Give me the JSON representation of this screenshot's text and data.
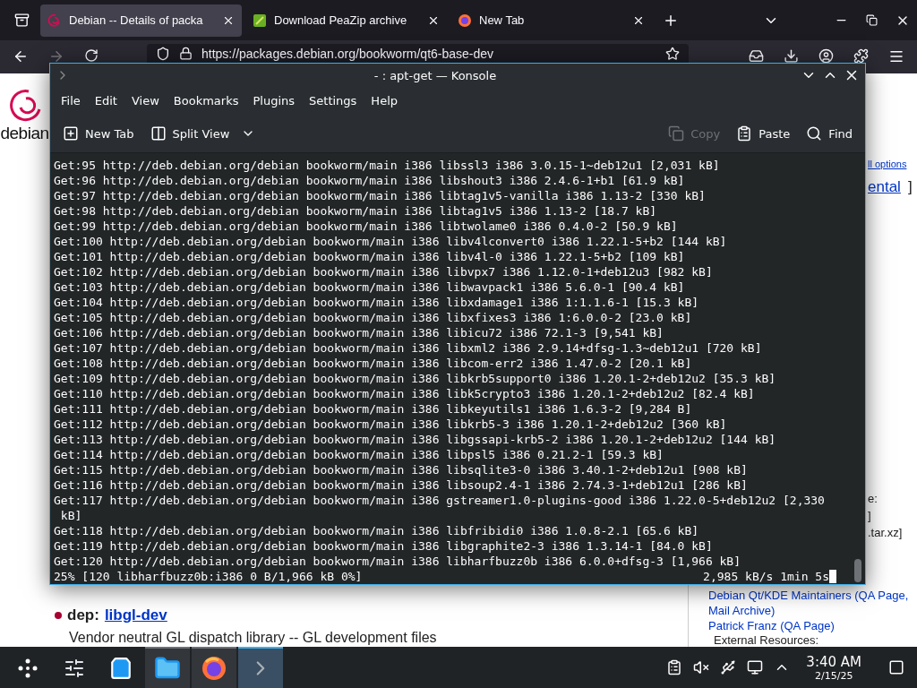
{
  "browser": {
    "tabs": [
      {
        "title": "Debian -- Details of packa",
        "kind": "debian",
        "selected": true
      },
      {
        "title": "Download PeaZip archive",
        "kind": "peazip",
        "selected": false
      },
      {
        "title": "New Tab",
        "kind": "firefox",
        "selected": false
      }
    ],
    "url": "https://packages.debian.org/bookworm/qt6-base-dev"
  },
  "page": {
    "logo_text": "debian",
    "side_top": {
      "options_link": "ll options",
      "suite_link": "ental",
      "suite_bracket": "]"
    },
    "side_files": [
      "e:",
      "]",
      ".tar.xz]"
    ],
    "maintainers": [
      "Debian Qt/KDE Maintainers (QA Page, Mail Archive)",
      "Patrick Franz (QA Page)"
    ],
    "external_heading": "External Resources:",
    "dep": {
      "label": "dep:",
      "link": "libgl-dev",
      "description": "Vendor neutral GL dispatch library -- GL development files"
    }
  },
  "konsole": {
    "title": "- : apt-get — Konsole",
    "menu": [
      "File",
      "Edit",
      "View",
      "Bookmarks",
      "Plugins",
      "Settings",
      "Help"
    ],
    "toolbar": [
      {
        "label": "New Tab",
        "kind": "new-tab",
        "disabled": false
      },
      {
        "label": "Split View",
        "kind": "split-view",
        "disabled": false
      },
      {
        "label": "Copy",
        "kind": "copy",
        "disabled": true
      },
      {
        "label": "Paste",
        "kind": "paste",
        "disabled": false
      },
      {
        "label": "Find",
        "kind": "find",
        "disabled": false
      }
    ],
    "lines": [
      "Get:95 http://deb.debian.org/debian bookworm/main i386 libssl3 i386 3.0.15-1~deb12u1 [2,031 kB]",
      "Get:96 http://deb.debian.org/debian bookworm/main i386 libshout3 i386 2.4.6-1+b1 [61.9 kB]",
      "Get:97 http://deb.debian.org/debian bookworm/main i386 libtag1v5-vanilla i386 1.13-2 [330 kB]",
      "Get:98 http://deb.debian.org/debian bookworm/main i386 libtag1v5 i386 1.13-2 [18.7 kB]",
      "Get:99 http://deb.debian.org/debian bookworm/main i386 libtwolame0 i386 0.4.0-2 [50.9 kB]",
      "Get:100 http://deb.debian.org/debian bookworm/main i386 libv4lconvert0 i386 1.22.1-5+b2 [144 kB]",
      "Get:101 http://deb.debian.org/debian bookworm/main i386 libv4l-0 i386 1.22.1-5+b2 [109 kB]",
      "Get:102 http://deb.debian.org/debian bookworm/main i386 libvpx7 i386 1.12.0-1+deb12u3 [982 kB]",
      "Get:103 http://deb.debian.org/debian bookworm/main i386 libwavpack1 i386 5.6.0-1 [90.4 kB]",
      "Get:104 http://deb.debian.org/debian bookworm/main i386 libxdamage1 i386 1:1.1.6-1 [15.3 kB]",
      "Get:105 http://deb.debian.org/debian bookworm/main i386 libxfixes3 i386 1:6.0.0-2 [23.0 kB]",
      "Get:106 http://deb.debian.org/debian bookworm/main i386 libicu72 i386 72.1-3 [9,541 kB]",
      "Get:107 http://deb.debian.org/debian bookworm/main i386 libxml2 i386 2.9.14+dfsg-1.3~deb12u1 [720 kB]",
      "Get:108 http://deb.debian.org/debian bookworm/main i386 libcom-err2 i386 1.47.0-2 [20.1 kB]",
      "Get:109 http://deb.debian.org/debian bookworm/main i386 libkrb5support0 i386 1.20.1-2+deb12u2 [35.3 kB]",
      "Get:110 http://deb.debian.org/debian bookworm/main i386 libk5crypto3 i386 1.20.1-2+deb12u2 [82.4 kB]",
      "Get:111 http://deb.debian.org/debian bookworm/main i386 libkeyutils1 i386 1.6.3-2 [9,284 B]",
      "Get:112 http://deb.debian.org/debian bookworm/main i386 libkrb5-3 i386 1.20.1-2+deb12u2 [360 kB]",
      "Get:113 http://deb.debian.org/debian bookworm/main i386 libgssapi-krb5-2 i386 1.20.1-2+deb12u2 [144 kB]",
      "Get:114 http://deb.debian.org/debian bookworm/main i386 libpsl5 i386 0.21.2-1 [59.3 kB]",
      "Get:115 http://deb.debian.org/debian bookworm/main i386 libsqlite3-0 i386 3.40.1-2+deb12u1 [908 kB]",
      "Get:116 http://deb.debian.org/debian bookworm/main i386 libsoup2.4-1 i386 2.74.3-1+deb12u1 [286 kB]",
      "Get:117 http://deb.debian.org/debian bookworm/main i386 gstreamer1.0-plugins-good i386 1.22.0-5+deb12u2 [2,330",
      " kB]",
      "Get:118 http://deb.debian.org/debian bookworm/main i386 libfribidi0 i386 1.0.8-2.1 [65.6 kB]",
      "Get:119 http://deb.debian.org/debian bookworm/main i386 libgraphite2-3 i386 1.3.14-1 [84.0 kB]",
      "Get:120 http://deb.debian.org/debian bookworm/main i386 libharfbuzz0b i386 6.0.0+dfsg-3 [1,966 kB]"
    ],
    "status": {
      "progress": "25% [120 libharfbuzz0b:i386 0 B/1,966 kB 0%]",
      "rate": "2,985 kB/s 1min 5s"
    }
  },
  "taskbar": {
    "apps": [
      {
        "kind": "settings",
        "running": false,
        "selected": false
      },
      {
        "kind": "store",
        "running": false,
        "selected": false
      },
      {
        "kind": "files",
        "running": true,
        "selected": false
      },
      {
        "kind": "firefox",
        "running": true,
        "selected": false
      },
      {
        "kind": "terminal",
        "running": true,
        "selected": true
      }
    ],
    "time": "3:40 AM",
    "date": "2/15/25"
  }
}
